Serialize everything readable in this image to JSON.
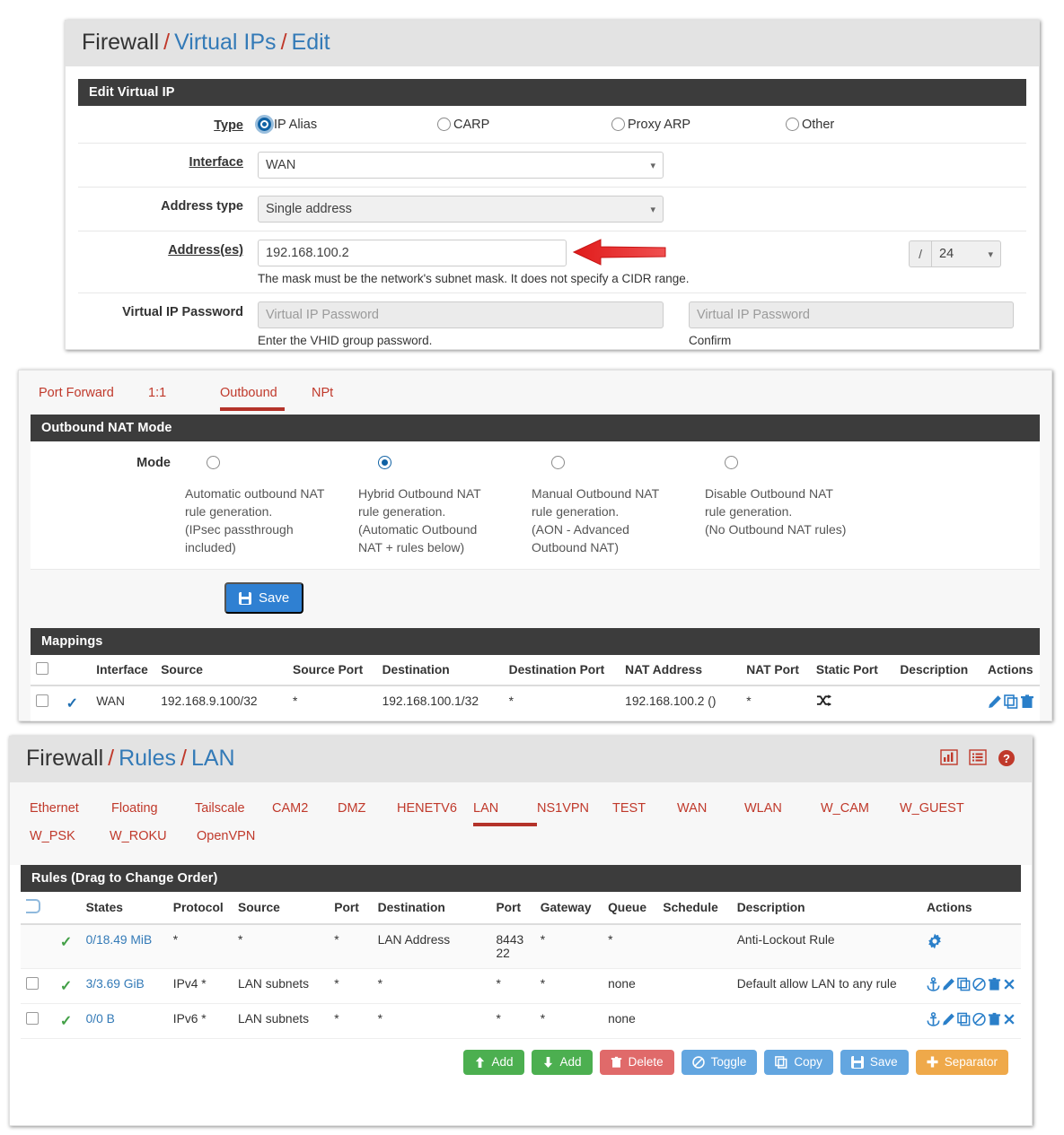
{
  "vip_panel": {
    "breadcrumb": {
      "root": "Firewall",
      "level1": "Virtual IPs",
      "level2": "Edit",
      "sep": "/"
    },
    "section_title": "Edit Virtual IP",
    "rows": {
      "type": {
        "label": "Type",
        "options": [
          {
            "label": "IP Alias",
            "checked": true
          },
          {
            "label": "CARP",
            "checked": false
          },
          {
            "label": "Proxy ARP",
            "checked": false
          },
          {
            "label": "Other",
            "checked": false
          }
        ]
      },
      "interface": {
        "label": "Interface",
        "value": "WAN"
      },
      "address_type": {
        "label": "Address type",
        "value": "Single address"
      },
      "addresses": {
        "label": "Address(es)",
        "value": "192.168.100.2",
        "help": "The mask must be the network's subnet mask. It does not specify a CIDR range.",
        "slash": "/",
        "cidr": "24"
      },
      "vip_password": {
        "label": "Virtual IP Password",
        "placeholder": "Virtual IP Password",
        "help": "Enter the VHID group password.",
        "confirm_placeholder": "Virtual IP Password",
        "confirm_help": "Confirm"
      }
    }
  },
  "nat_panel": {
    "tabs": [
      {
        "label": "Port Forward",
        "active": false
      },
      {
        "label": "1:1",
        "active": false
      },
      {
        "label": "Outbound",
        "active": true
      },
      {
        "label": "NPt",
        "active": false
      }
    ],
    "section_title": "Outbound NAT Mode",
    "mode_label": "Mode",
    "modes": [
      {
        "checked": false,
        "lines": [
          "Automatic outbound NAT",
          "rule generation.",
          "(IPsec passthrough",
          "included)"
        ]
      },
      {
        "checked": true,
        "lines": [
          "Hybrid Outbound NAT",
          "rule generation.",
          "(Automatic Outbound",
          "NAT + rules below)"
        ]
      },
      {
        "checked": false,
        "lines": [
          "Manual Outbound NAT",
          "rule generation.",
          "(AON - Advanced",
          "Outbound NAT)"
        ]
      },
      {
        "checked": false,
        "lines": [
          "Disable Outbound NAT",
          "rule generation.",
          "(No Outbound NAT rules)"
        ]
      }
    ],
    "save_label": "Save",
    "mappings_title": "Mappings",
    "mappings_columns": [
      "Interface",
      "Source",
      "Source Port",
      "Destination",
      "Destination Port",
      "NAT Address",
      "NAT Port",
      "Static Port",
      "Description",
      "Actions"
    ],
    "mappings_rows": [
      {
        "interface": "WAN",
        "source": "192.168.9.100/32",
        "source_port": "*",
        "destination": "192.168.100.1/32",
        "destination_port": "*",
        "nat_address": "192.168.100.2 ()",
        "nat_port": "*",
        "static_port": "shuffle-icon",
        "description": ""
      }
    ]
  },
  "rules_panel": {
    "breadcrumb": {
      "root": "Firewall",
      "level1": "Rules",
      "level2": "LAN",
      "sep": "/"
    },
    "header_icons": [
      "bar-chart-icon",
      "list-icon",
      "help-icon"
    ],
    "interface_tabs": [
      {
        "label": "Ethernet",
        "active": false
      },
      {
        "label": "Floating",
        "active": false
      },
      {
        "label": "Tailscale",
        "active": false
      },
      {
        "label": "CAM2",
        "active": false
      },
      {
        "label": "DMZ",
        "active": false
      },
      {
        "label": "HENETV6",
        "active": false
      },
      {
        "label": "LAN",
        "active": true
      },
      {
        "label": "NS1VPN",
        "active": false
      },
      {
        "label": "TEST",
        "active": false
      },
      {
        "label": "WAN",
        "active": false
      },
      {
        "label": "WLAN",
        "active": false
      },
      {
        "label": "W_CAM",
        "active": false
      },
      {
        "label": "W_GUEST",
        "active": false
      },
      {
        "label": "W_PSK",
        "active": false
      },
      {
        "label": "W_ROKU",
        "active": false
      },
      {
        "label": "OpenVPN",
        "active": false
      }
    ],
    "section_title": "Rules (Drag to Change Order)",
    "columns": [
      "States",
      "Protocol",
      "Source",
      "Port",
      "Destination",
      "Port",
      "Gateway",
      "Queue",
      "Schedule",
      "Description",
      "Actions"
    ],
    "rows": [
      {
        "has_checkbox": false,
        "states": "0/18.49 MiB",
        "protocol": "*",
        "source": "*",
        "source_port": "*",
        "destination": "LAN Address",
        "dest_port": "8443\n22",
        "gateway": "*",
        "queue": "*",
        "schedule": "",
        "description": "Anti-Lockout Rule",
        "actions": [
          "gear-icon"
        ]
      },
      {
        "has_checkbox": true,
        "states": "3/3.69 GiB",
        "protocol": "IPv4 *",
        "source": "LAN subnets",
        "source_port": "*",
        "destination": "*",
        "dest_port": "*",
        "gateway": "*",
        "queue": "none",
        "schedule": "",
        "description": "Default allow LAN to any rule",
        "actions": [
          "anchor-icon",
          "pencil-icon",
          "copy-icon",
          "block-icon",
          "trash-icon",
          "close-icon"
        ]
      },
      {
        "has_checkbox": true,
        "states": "0/0 B",
        "protocol": "IPv6 *",
        "source": "LAN subnets",
        "source_port": "*",
        "destination": "*",
        "dest_port": "*",
        "gateway": "*",
        "queue": "none",
        "schedule": "",
        "description": "",
        "actions": [
          "anchor-icon",
          "pencil-icon",
          "copy-icon",
          "block-icon",
          "trash-icon",
          "close-icon"
        ]
      }
    ],
    "buttons": [
      {
        "label": "Add",
        "icon": "arrow-up-icon",
        "color": "green"
      },
      {
        "label": "Add",
        "icon": "arrow-down-icon",
        "color": "green"
      },
      {
        "label": "Delete",
        "icon": "trash-icon",
        "color": "red"
      },
      {
        "label": "Toggle",
        "icon": "block-icon",
        "color": "blue"
      },
      {
        "label": "Copy",
        "icon": "copy-icon",
        "color": "blue"
      },
      {
        "label": "Save",
        "icon": "floppy-icon",
        "color": "blue"
      },
      {
        "label": "Separator",
        "icon": "plus-icon",
        "color": "orange"
      }
    ]
  },
  "colors": {
    "accent_red": "#c0392b",
    "link_blue": "#337ab7",
    "dark_header": "#3c3c3c",
    "radio_blue": "#1062a4",
    "green": "#4caf50"
  }
}
